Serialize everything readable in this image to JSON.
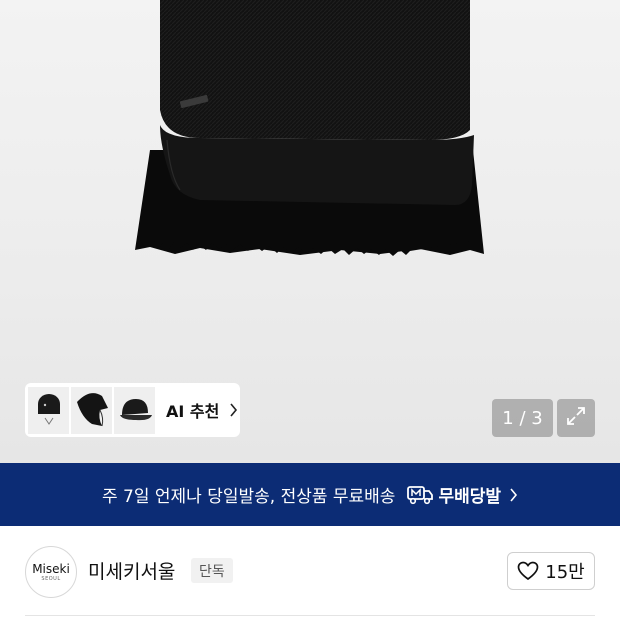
{
  "gallery": {
    "pager_current": "1",
    "pager_separator": "/",
    "pager_total": "3",
    "image_count_text": "1 / 3"
  },
  "ai_recommend": {
    "label": "AI 추천",
    "thumbnails": [
      "hat-thumbnail-1",
      "hat-thumbnail-2",
      "hat-thumbnail-3"
    ]
  },
  "delivery_banner": {
    "text": "주 7일 언제나 당일발송, 전상품 무료배송",
    "brand": "무배당발",
    "background": "#0c2c75"
  },
  "seller": {
    "logo_text": "Miseki",
    "logo_subtext": "SEOUL",
    "name": "미세키서울",
    "badge": "단독"
  },
  "like": {
    "count": "15만"
  },
  "icons": {
    "expand": "expand-icon",
    "chevron": "chevron-right-icon",
    "heart": "heart-icon",
    "delivery": "delivery-truck-icon"
  }
}
